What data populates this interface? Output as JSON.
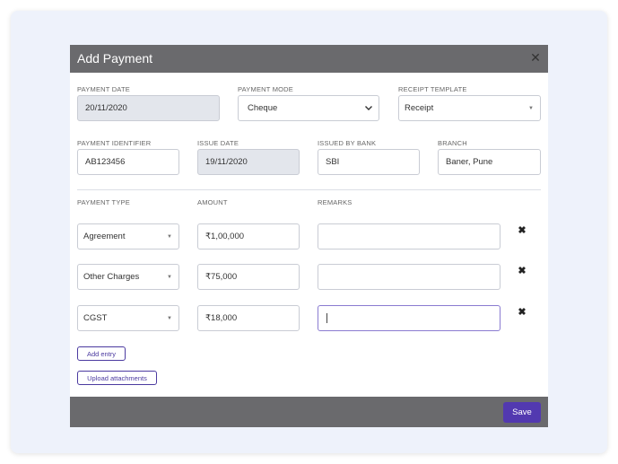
{
  "modal": {
    "title": "Add Payment",
    "close_glyph": "✕"
  },
  "row1": {
    "payment_date": {
      "label": "PAYMENT DATE",
      "value": "20/11/2020"
    },
    "payment_mode": {
      "label": "PAYMENT MODE",
      "value": "Cheque"
    },
    "receipt_template": {
      "label": "RECEIPT TEMPLATE",
      "value": "Receipt"
    }
  },
  "row2": {
    "payment_identifier": {
      "label": "PAYMENT IDENTIFIER",
      "value": "AB123456"
    },
    "issue_date": {
      "label": "ISSUE DATE",
      "value": "19/11/2020"
    },
    "issued_by_bank": {
      "label": "ISSUED BY BANK",
      "value": "SBI"
    },
    "branch": {
      "label": "BRANCH",
      "value": "Baner, Pune"
    }
  },
  "entries_header": {
    "payment_type": "PAYMENT TYPE",
    "amount": "AMOUNT",
    "remarks": "REMARKS"
  },
  "entries": [
    {
      "type": "Agreement",
      "amount": "₹1,00,000",
      "remarks": ""
    },
    {
      "type": "Other Charges",
      "amount": "₹75,000",
      "remarks": ""
    },
    {
      "type": "CGST",
      "amount": "₹18,000",
      "remarks": ""
    }
  ],
  "icons": {
    "remove": "✖",
    "dropdown": "▼"
  },
  "actions": {
    "add_entry": "Add entry",
    "upload_attachments": "Upload attachments",
    "save": "Save"
  },
  "colors": {
    "header_bg": "#6a6a6d",
    "accent": "#5239b0",
    "card_bg": "#eef2fb"
  }
}
